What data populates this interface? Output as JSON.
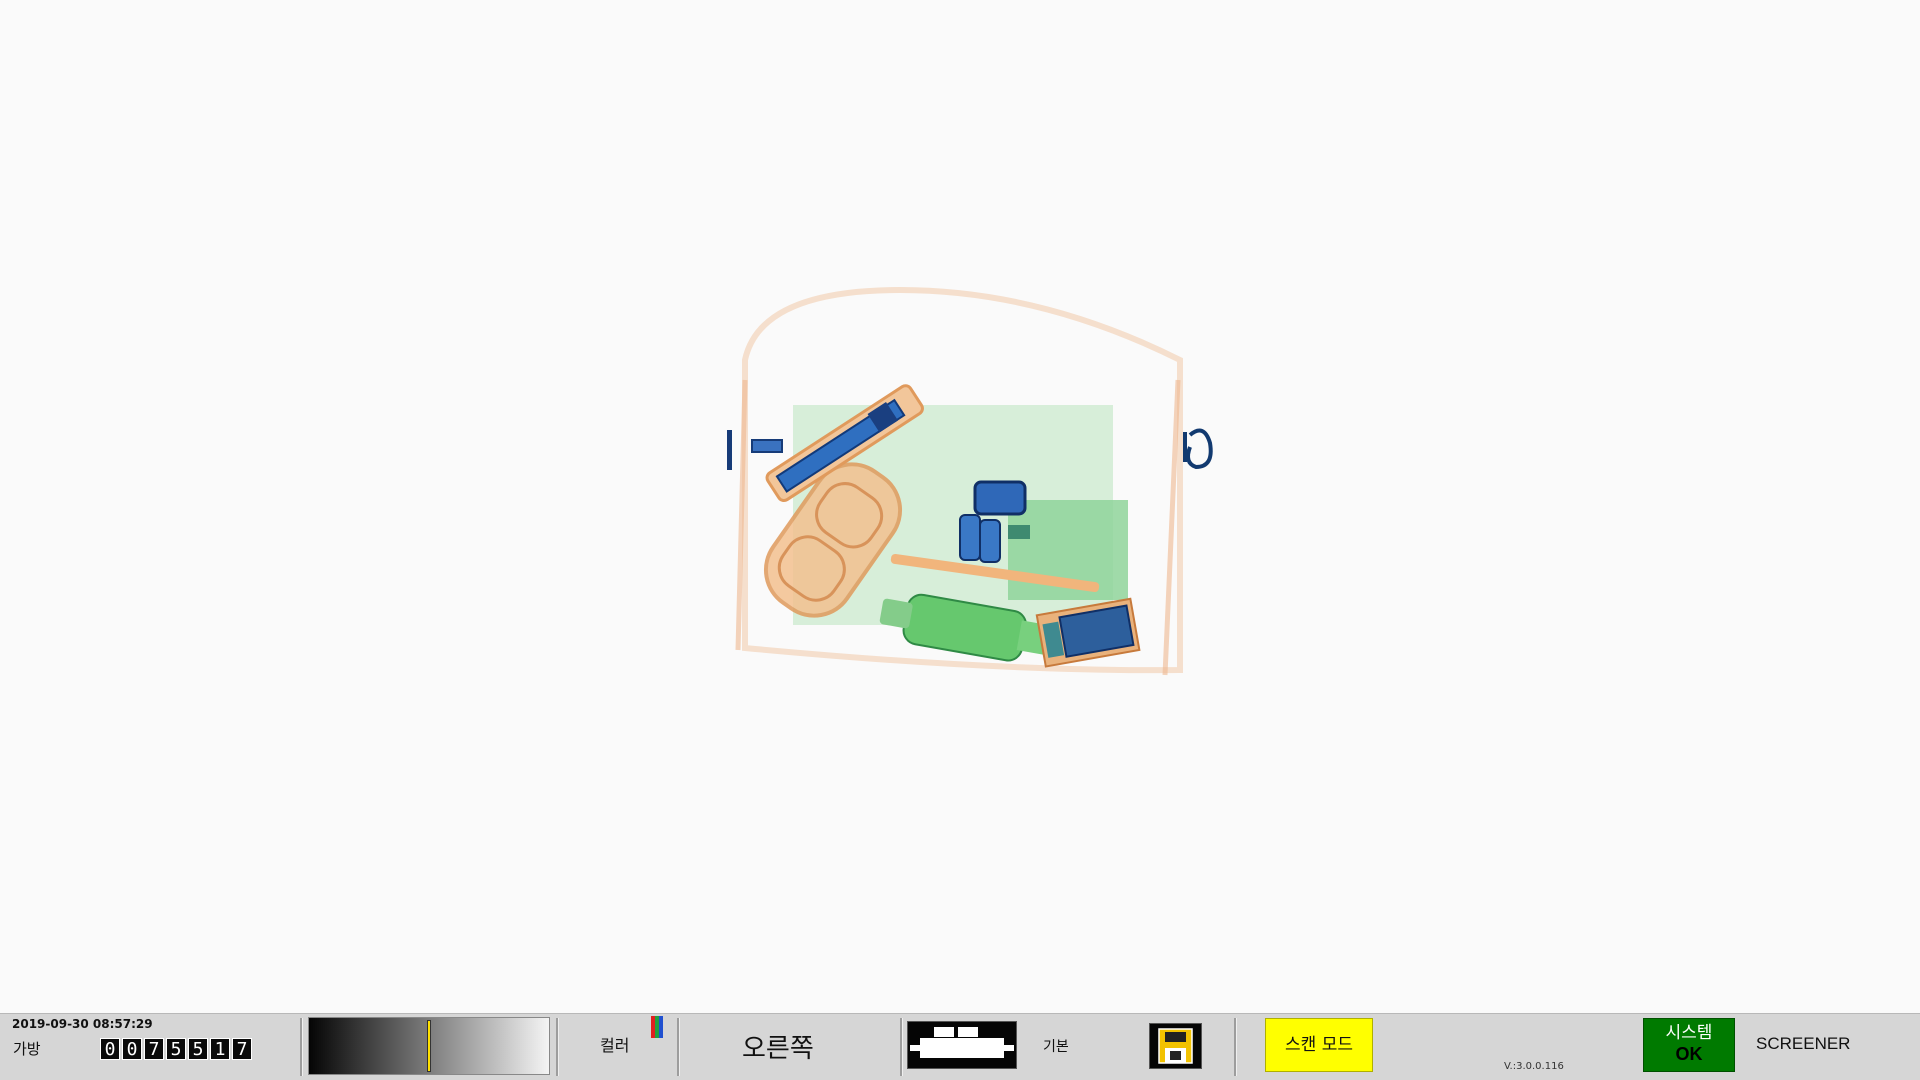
{
  "status_bar": {
    "timestamp": "2019-09-30 08:57:29",
    "bag_label": "가방",
    "bag_counter": [
      "0",
      "0",
      "7",
      "5",
      "5",
      "1",
      "7"
    ],
    "gray_level": 0.5,
    "color_label": "컬러",
    "color_icon": "color-bars-icon",
    "side_label": "오른쪽",
    "belt_icon": "conveyor-belt-icon",
    "mode_label": "기본",
    "disk_icon": "save-disk-icon",
    "scan_mode_label": "스캔 모드",
    "version": "V.:3.0.0.116",
    "system_label": "시스템",
    "system_value": "OK",
    "user_role": "SCREENER"
  },
  "colors": {
    "statusbar_bg": "#d6d6d6",
    "scan_mode_bg": "#ffff00",
    "system_ok_bg": "#007a00",
    "xray_organic": "#f0a060",
    "xray_inorganic": "#60c070",
    "xray_metal": "#2060b0"
  }
}
